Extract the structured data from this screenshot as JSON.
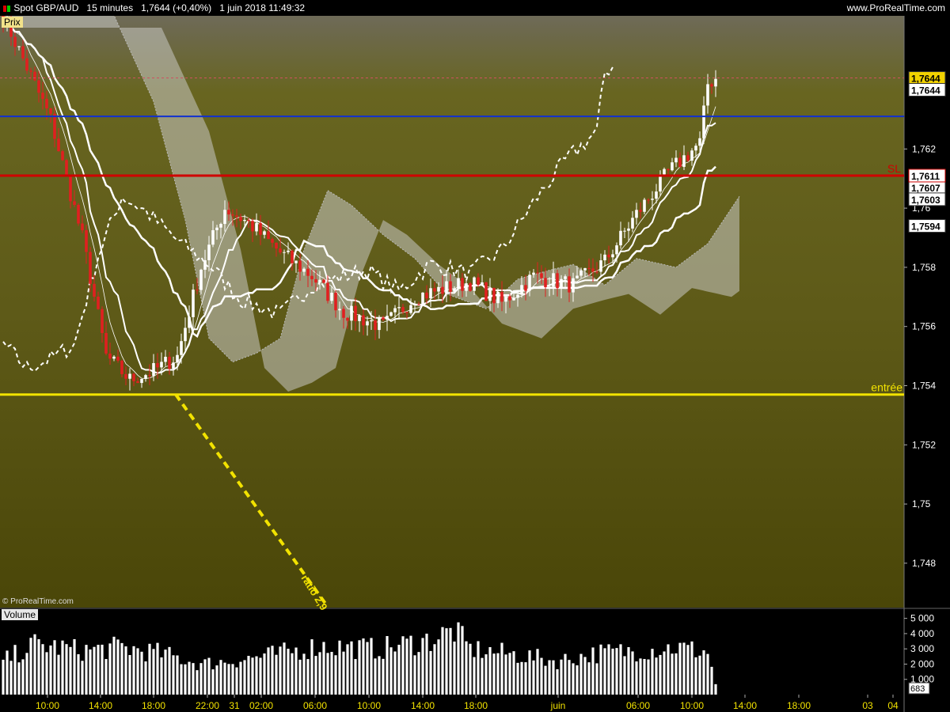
{
  "header": {
    "instrument": "Spot GBP/AUD",
    "timeframe": "15 minutes",
    "last": "1,7644 (+0,40%)",
    "datetime": "1 juin 2018 11:49:32",
    "site": "www.ProRealTime.com"
  },
  "panels": {
    "price": "Prix",
    "volume": "Volume"
  },
  "copyright": "© ProRealTime.com",
  "colors": {
    "accent": "#f2e200",
    "up": "#ffffff",
    "down": "#e02020",
    "resistance": "#d00000",
    "upper_line": "#1030d0"
  },
  "chart_data": [
    {
      "type": "candlestick",
      "ylim": [
        1.7465,
        1.7665
      ],
      "y_ticks": [
        "1,748",
        "1,75",
        "1,752",
        "1,754",
        "1,756",
        "1,758",
        "1,76",
        "1,762"
      ],
      "x_ticks": [
        "10:00",
        "14:00",
        "18:00",
        "22:00",
        "31",
        "02:00",
        "06:00",
        "10:00",
        "14:00",
        "18:00",
        "juin",
        "06:00",
        "10:00",
        "14:00",
        "18:00",
        "03",
        "04"
      ],
      "horizontal_lines": [
        {
          "label": "",
          "value": 1.7631,
          "tag": ""
        },
        {
          "label": "SL",
          "value": 1.7611,
          "tag": "1,7611"
        },
        {
          "label": "entrée",
          "value": 1.7537,
          "tag": ""
        }
      ],
      "right_tags": [
        {
          "text": "1,7644",
          "value": 1.7644,
          "highlight": true
        },
        {
          "text": "1,7644",
          "value": 1.764,
          "highlight": false
        },
        {
          "text": "1,7607",
          "value": 1.7607,
          "highlight": false
        },
        {
          "text": "1,7603",
          "value": 1.7603,
          "highlight": false
        },
        {
          "text": "1,7594",
          "value": 1.7594,
          "highlight": false
        }
      ],
      "annotation": {
        "text": "ratio 2,9",
        "from_value": 1.7537,
        "to_value": 1.7466
      },
      "price_path": [
        [
          0,
          1.7665
        ],
        [
          12,
          1.763
        ],
        [
          20,
          1.759
        ],
        [
          26,
          1.755
        ],
        [
          32,
          1.7542
        ],
        [
          38,
          1.7545
        ],
        [
          44,
          1.755
        ],
        [
          50,
          1.758
        ],
        [
          56,
          1.76
        ],
        [
          62,
          1.7595
        ],
        [
          70,
          1.7585
        ],
        [
          78,
          1.7577
        ],
        [
          86,
          1.7565
        ],
        [
          96,
          1.756
        ],
        [
          104,
          1.757
        ],
        [
          112,
          1.7573
        ],
        [
          118,
          1.7575
        ],
        [
          126,
          1.7568
        ],
        [
          134,
          1.7577
        ],
        [
          144,
          1.7574
        ],
        [
          152,
          1.7582
        ],
        [
          160,
          1.7598
        ],
        [
          168,
          1.7612
        ],
        [
          176,
          1.7622
        ],
        [
          178,
          1.7642
        ],
        [
          180,
          1.7644
        ]
      ]
    },
    {
      "type": "bar",
      "name": "Volume",
      "ylim": [
        0,
        5500
      ],
      "y_ticks": [
        "5 000",
        "4 000",
        "3 000",
        "2 000",
        "1 000"
      ],
      "last_tag": "683",
      "level_path": [
        [
          0,
          2200
        ],
        [
          8,
          3300
        ],
        [
          20,
          2900
        ],
        [
          30,
          3100
        ],
        [
          40,
          2700
        ],
        [
          50,
          2000
        ],
        [
          60,
          2300
        ],
        [
          70,
          2700
        ],
        [
          80,
          3200
        ],
        [
          95,
          3000
        ],
        [
          108,
          3600
        ],
        [
          114,
          4200
        ],
        [
          118,
          3000
        ],
        [
          130,
          2600
        ],
        [
          140,
          2200
        ],
        [
          150,
          2700
        ],
        [
          160,
          2900
        ],
        [
          170,
          3100
        ],
        [
          178,
          2800
        ],
        [
          180,
          683
        ]
      ]
    }
  ]
}
